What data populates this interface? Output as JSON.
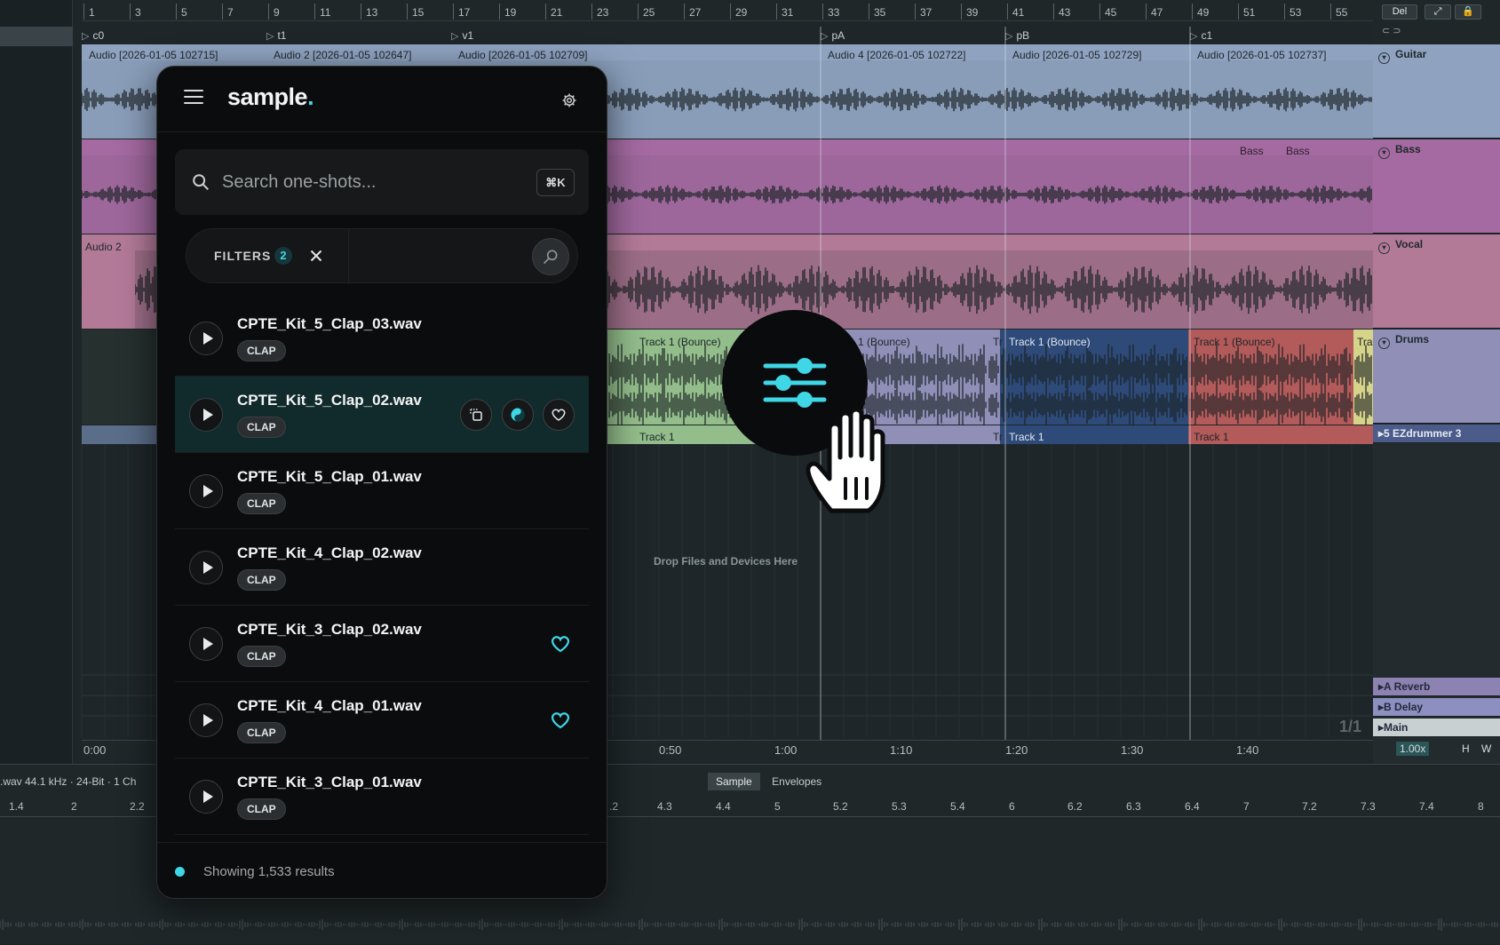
{
  "daw": {
    "ruler_ticks": [
      "1",
      "3",
      "5",
      "7",
      "9",
      "11",
      "13",
      "15",
      "17",
      "19",
      "21",
      "23",
      "25",
      "27",
      "29",
      "31",
      "33",
      "35",
      "37",
      "39",
      "41",
      "43",
      "45",
      "47",
      "49",
      "51",
      "53",
      "55"
    ],
    "locators": [
      "c0",
      "t1",
      "v1",
      "pA",
      "pB",
      "c1"
    ],
    "clips_row1": [
      "Audio [2026-01-05 102715]",
      "Audio 2 [2026-01-05 102647]",
      "Audio [2026-01-05 102709]",
      "Audio 4 [2026-01-05 102722]",
      "Audio [2026-01-05 102729]",
      "Audio [2026-01-05 102737]"
    ],
    "bass_clips": [
      "Bass",
      "Bass"
    ],
    "audio2_clip": "Audio 2",
    "drum_clips": [
      "Track 1 (Bounce)",
      "1 (Bounce)",
      "Tr",
      "Track 1 (Bounce)",
      "Track 1 (Bounce)",
      "Tra"
    ],
    "drum_footer_clips": [
      "Track 1",
      "Tr",
      "Track 1",
      "Track 1"
    ],
    "tracks": [
      "Guitar",
      "Bass",
      "Vocal",
      "Drums"
    ],
    "instrument_track": "5 EZdrummer 3",
    "returns": [
      "A Reverb",
      "B Delay",
      "Main"
    ],
    "drop_hint": "Drop Files and Devices Here",
    "page_indicator": "1/1",
    "time_labels": [
      "0:00",
      "0:50",
      "1:00",
      "1:10",
      "1:20",
      "1:30",
      "1:40"
    ],
    "zoom": "1.00x",
    "hw_buttons": [
      "H",
      "W"
    ],
    "top_buttons": [
      "Del"
    ],
    "sample_info": ".wav  44.1 kHz · 24-Bit · 1 Ch",
    "detail_tabs": [
      "Sample",
      "Envelopes"
    ],
    "sample_ruler": [
      "1.4",
      "2",
      "2.2",
      ".2",
      "4.3",
      "4.4",
      "5",
      "5.2",
      "5.3",
      "5.4",
      "6",
      "6.2",
      "6.3",
      "6.4",
      "7",
      "7.2",
      "7.3",
      "7.4",
      "8"
    ]
  },
  "panel": {
    "logo": "sample",
    "logo_dot": ".",
    "search_placeholder": "Search one-shots...",
    "shortcut": "⌘K",
    "filters_label": "FILTERS",
    "filters_count": "2",
    "results": [
      {
        "name": "CPTE_Kit_5_Clap_03.wav",
        "tag": "CLAP",
        "favorite": false
      },
      {
        "name": "CPTE_Kit_5_Clap_02.wav",
        "tag": "CLAP",
        "favorite": false
      },
      {
        "name": "CPTE_Kit_5_Clap_01.wav",
        "tag": "CLAP",
        "favorite": false
      },
      {
        "name": "CPTE_Kit_4_Clap_02.wav",
        "tag": "CLAP",
        "favorite": false
      },
      {
        "name": "CPTE_Kit_3_Clap_02.wav",
        "tag": "CLAP",
        "favorite": true
      },
      {
        "name": "CPTE_Kit_4_Clap_01.wav",
        "tag": "CLAP",
        "favorite": true
      },
      {
        "name": "CPTE_Kit_3_Clap_01.wav",
        "tag": "CLAP",
        "favorite": false
      }
    ],
    "status": "Showing 1,533 results",
    "accent": "#3fd6e6"
  },
  "colors": {
    "guitar": "#8fa3c1",
    "bass": "#a46aa1",
    "vocal": "#b37a98",
    "drum_green": "#93bd8b",
    "drum_lilac": "#8f8fb8",
    "drum_blue": "#2e4a78",
    "drum_red": "#b35a5a",
    "drum_yellow": "#d6d38a"
  }
}
